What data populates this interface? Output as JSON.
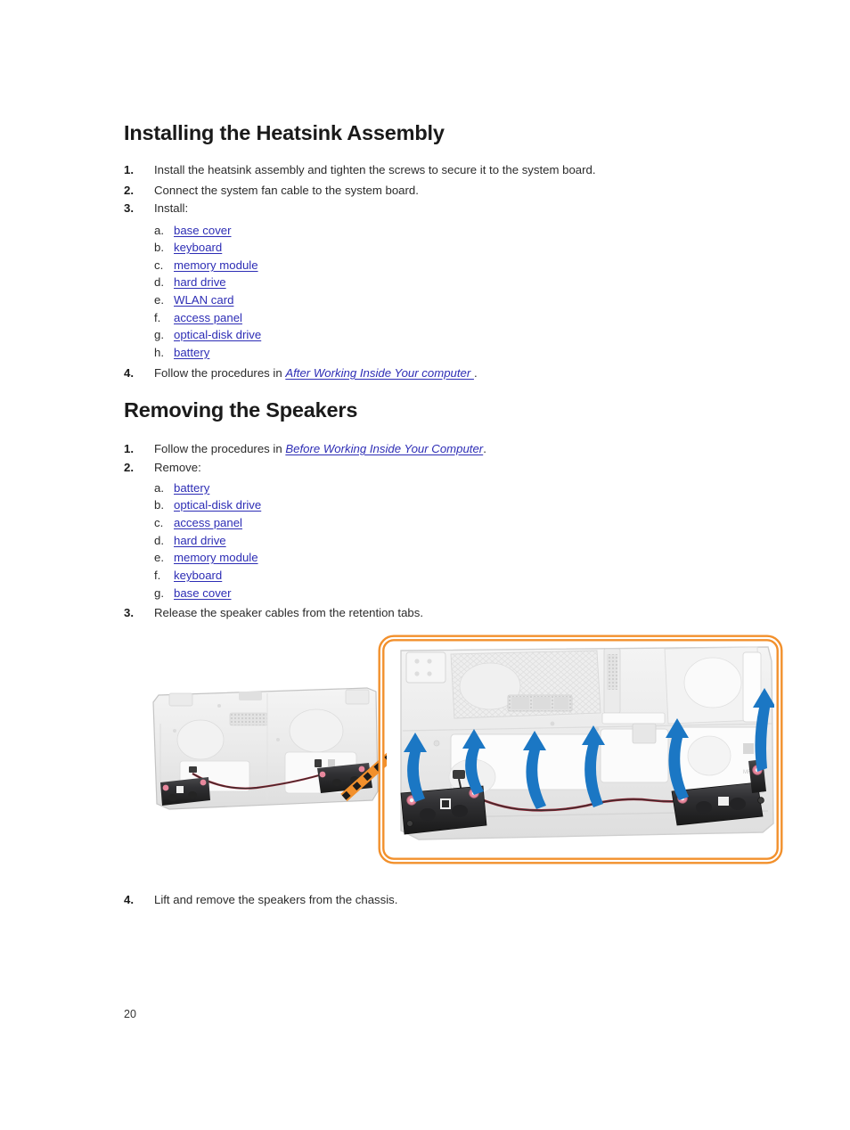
{
  "document": {
    "page_number": "20"
  },
  "sections": [
    {
      "heading": "Installing the Heatsink Assembly",
      "steps": [
        {
          "marker": "1.",
          "text": "Install the heatsink assembly and tighten the screws to secure it to the system board."
        },
        {
          "marker": "2.",
          "text": "Connect the system fan cable to the system board."
        },
        {
          "marker": "3.",
          "text": "Install:"
        }
      ],
      "substeps": [
        {
          "marker": "a.",
          "link": "base cover"
        },
        {
          "marker": "b.",
          "link": "keyboard"
        },
        {
          "marker": "c.",
          "link": "memory module"
        },
        {
          "marker": "d.",
          "link": "hard drive"
        },
        {
          "marker": "e.",
          "link": "WLAN card"
        },
        {
          "marker": "f.",
          "link": "access panel"
        },
        {
          "marker": "g.",
          "link": "optical-disk drive"
        },
        {
          "marker": "h.",
          "link": "battery"
        }
      ],
      "final_step": {
        "marker": "4.",
        "prefix": "Follow the procedures in ",
        "link": "After Working Inside Your computer ",
        "suffix": "."
      }
    },
    {
      "heading": "Removing the Speakers",
      "step1": {
        "marker": "1.",
        "prefix": "Follow the procedures in ",
        "link": "Before Working Inside Your Computer",
        "suffix": "."
      },
      "step2": {
        "marker": "2.",
        "text": "Remove:"
      },
      "substeps": [
        {
          "marker": "a.",
          "link": "battery"
        },
        {
          "marker": "b.",
          "link": "optical-disk drive"
        },
        {
          "marker": "c.",
          "link": "access panel"
        },
        {
          "marker": "d.",
          "link": "hard drive"
        },
        {
          "marker": "e.",
          "link": "memory module"
        },
        {
          "marker": "f.",
          "link": "keyboard"
        },
        {
          "marker": "g.",
          "link": "base cover"
        }
      ],
      "step3": {
        "marker": "3.",
        "text": "Release the speaker cables from the retention tabs."
      },
      "step4": {
        "marker": "4.",
        "text": "Lift and remove the speakers from the chassis."
      }
    }
  ],
  "figure": {
    "description": "Laptop chassis bottom view with speakers and routed speaker cables, magnified callout",
    "callout_border_color": "#F2902C",
    "arrow_color": "#1B77C4",
    "speaker_color": "#2f2f31",
    "grommet_color": "#e8889d",
    "chassis_color": "#ececec",
    "arrow_count": 6
  }
}
